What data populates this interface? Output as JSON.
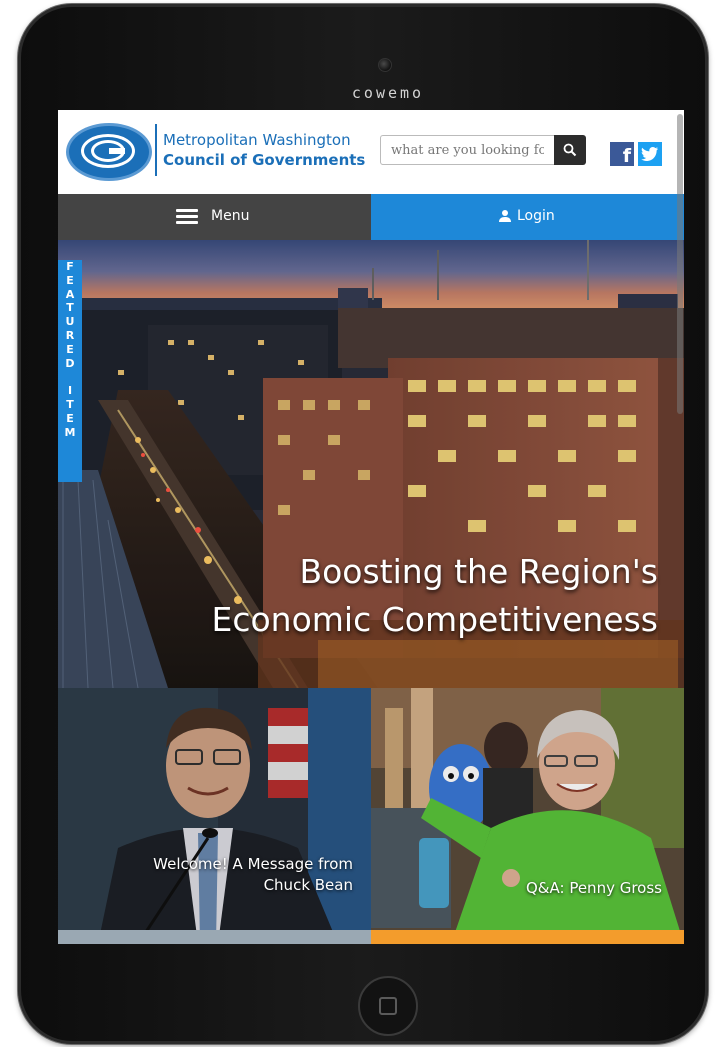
{
  "device": {
    "brand": "cowemo"
  },
  "header": {
    "org_line1": "Metropolitan Washington",
    "org_line2": "Council of Governments",
    "search_placeholder": "what are you looking for?",
    "search_icon": "search-icon",
    "facebook_label": "f",
    "twitter_icon": "twitter-icon"
  },
  "nav": {
    "menu_label": "Menu",
    "login_label": "Login"
  },
  "hero": {
    "featured_letters": [
      "F",
      "E",
      "A",
      "T",
      "U",
      "R",
      "E",
      "D",
      " ",
      "I",
      "T",
      "E",
      "M"
    ],
    "title_line1": "Boosting the Region's",
    "title_line2": "Economic Competitiveness"
  },
  "cards": [
    {
      "caption_line1": "Welcome! A Message from",
      "caption_line2": "Chuck Bean",
      "accent": "#9aa8b3"
    },
    {
      "caption_line1": "Q&A: Penny Gross",
      "caption_line2": "",
      "accent": "#f39c2c"
    }
  ],
  "colors": {
    "brand_blue": "#1b6fb8",
    "login_blue": "#1e88d8",
    "menu_gray": "#444444"
  }
}
